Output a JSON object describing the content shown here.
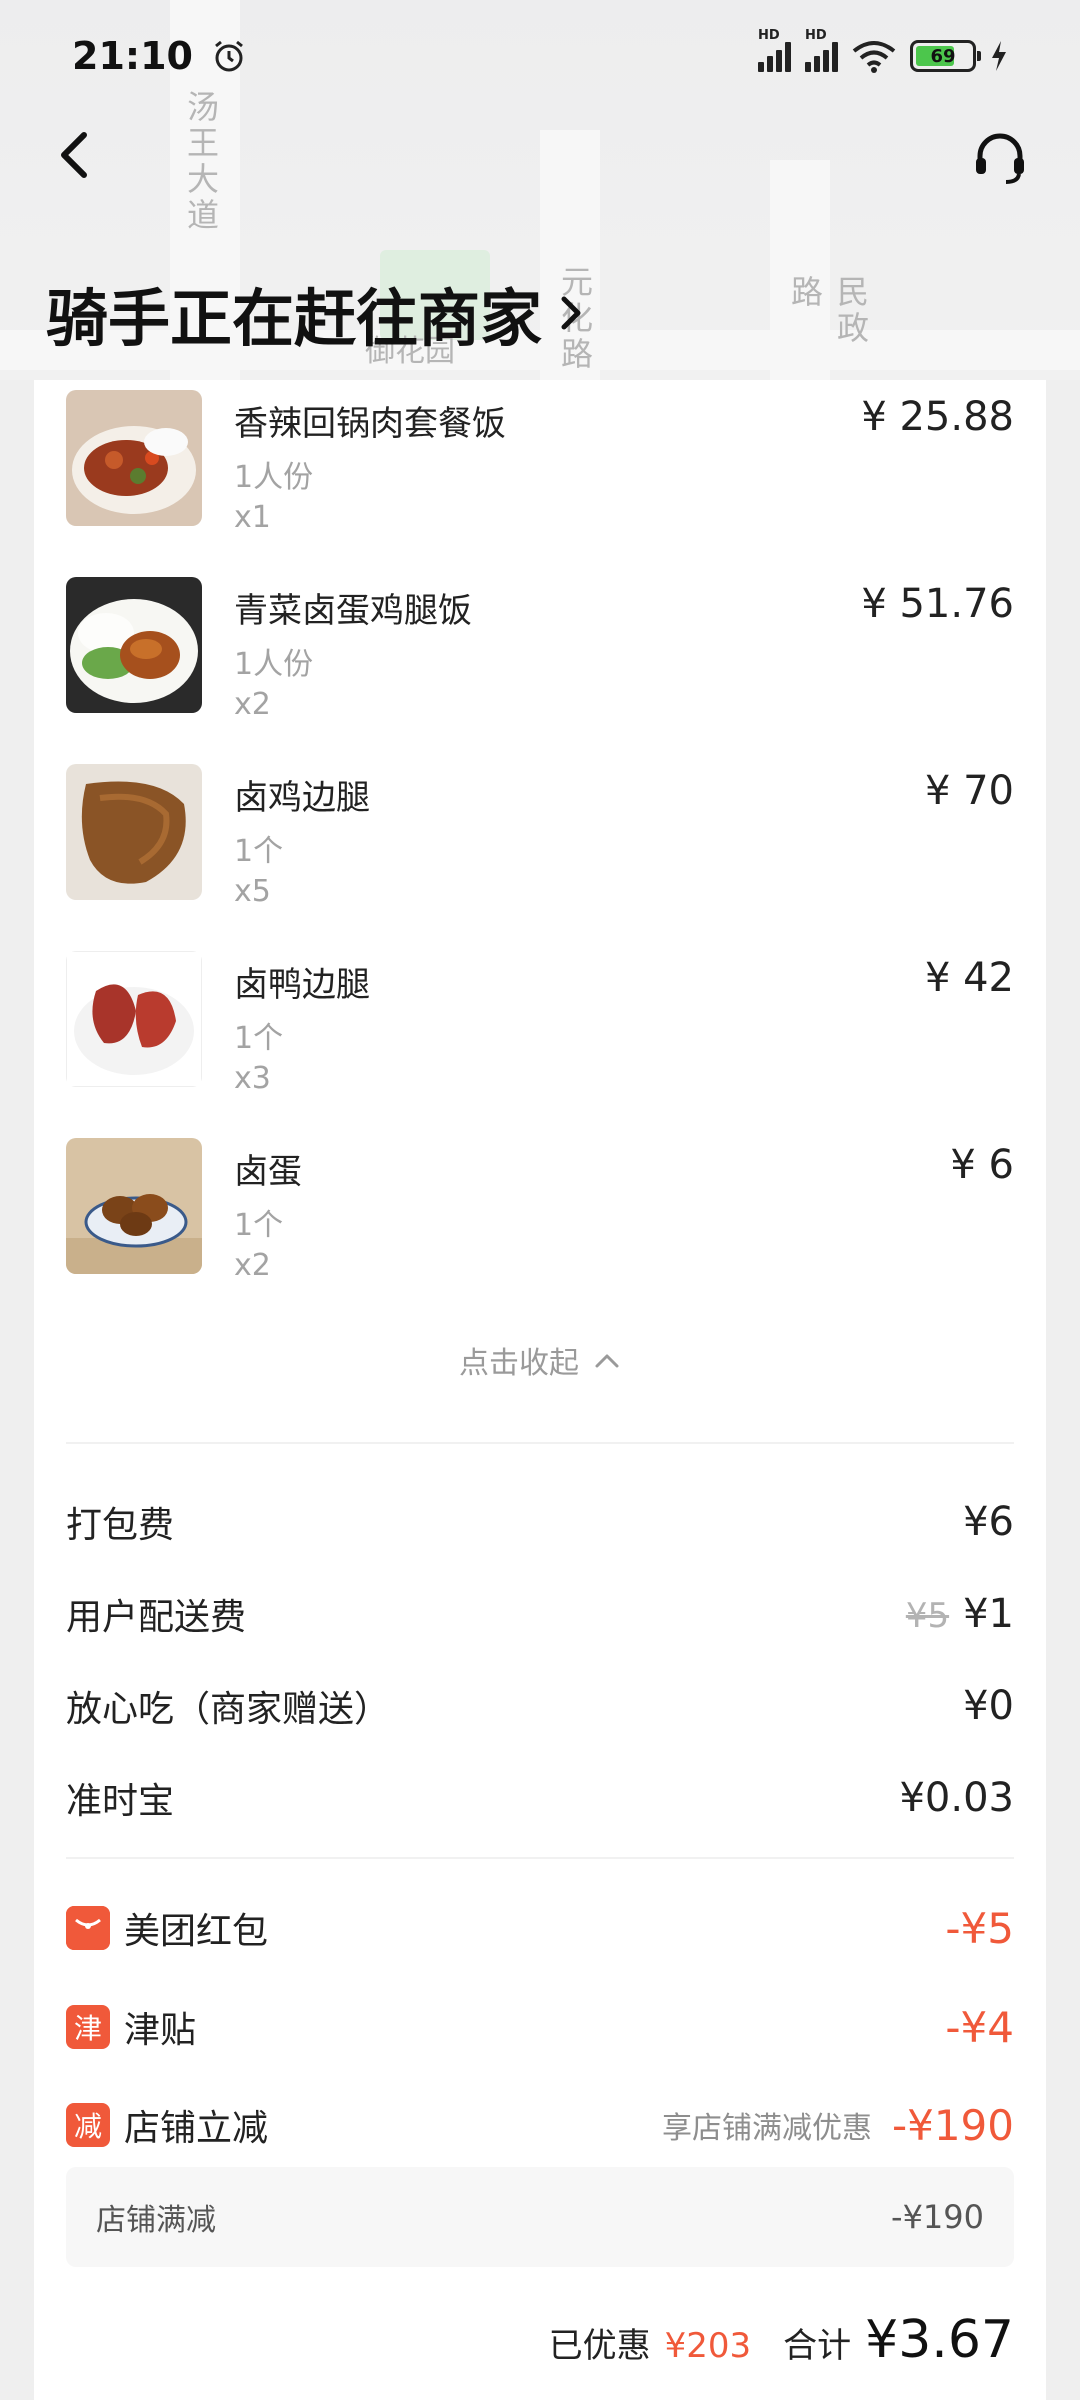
{
  "status_bar": {
    "time": "21:10",
    "battery_level": "69",
    "icons": [
      "alarm-icon",
      "hd-signal-icon",
      "hd-signal-icon",
      "wifi-icon",
      "battery-icon",
      "charging-bolt-icon"
    ]
  },
  "map": {
    "road_labels": [
      "汤王大道",
      "元化路",
      "民政路"
    ],
    "place_label": "御花园"
  },
  "header": {
    "back_icon": "chevron-left-icon",
    "support_icon": "headset-icon",
    "title": "骑手正在赶往商家"
  },
  "items": [
    {
      "name": "香辣回锅肉套餐饭",
      "spec": "1人份",
      "qty": "x1",
      "price": "¥ 25.88"
    },
    {
      "name": "青菜卤蛋鸡腿饭",
      "spec": "1人份",
      "qty": "x2",
      "price": "¥ 51.76"
    },
    {
      "name": "卤鸡边腿",
      "spec": "1个",
      "qty": "x5",
      "price": "¥ 70"
    },
    {
      "name": "卤鸭边腿",
      "spec": "1个",
      "qty": "x3",
      "price": "¥ 42"
    },
    {
      "name": "卤蛋",
      "spec": "1个",
      "qty": "x2",
      "price": "¥ 6"
    }
  ],
  "collapse_label": "点击收起",
  "fees": {
    "packing": {
      "label": "打包费",
      "value": "¥6"
    },
    "delivery": {
      "label": "用户配送费",
      "original": "¥5",
      "value": "¥1"
    },
    "safe_eat": {
      "label": "放心吃（商家赠送）",
      "value": "¥0"
    },
    "on_time": {
      "label": "准时宝",
      "value": "¥0.03"
    }
  },
  "discounts": {
    "red_packet": {
      "badge_icon": "red-packet-icon",
      "label": "美团红包",
      "value": "-¥5"
    },
    "subsidy": {
      "badge": "津",
      "label": "津贴",
      "value": "-¥4"
    },
    "store_cut": {
      "badge": "减",
      "label": "店铺立减",
      "note": "享店铺满减优惠",
      "value": "-¥190"
    },
    "store_full_cut": {
      "label": "店铺满减",
      "value": "-¥190"
    }
  },
  "totals": {
    "saved_label": "已优惠",
    "saved_value": "¥203",
    "total_label": "合计",
    "total_value": "¥3.67"
  },
  "colors": {
    "accent": "#f0593a",
    "muted": "#a3a3a3",
    "battery": "#4cc64c"
  }
}
